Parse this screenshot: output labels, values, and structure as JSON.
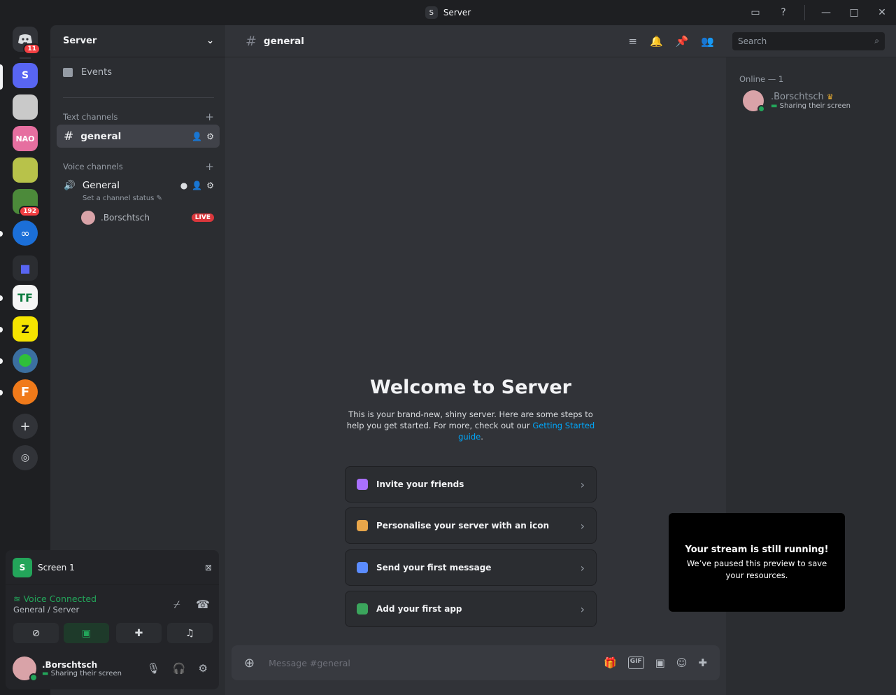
{
  "window": {
    "title": "Server",
    "server_initial": "S"
  },
  "rail": {
    "dm_badge": "11",
    "server_badges": {
      "game": "192"
    }
  },
  "sidebar": {
    "server_name": "Server",
    "events_label": "Events",
    "text_category": "Text channels",
    "voice_category": "Voice channels",
    "text_channel": "general",
    "voice_channel": "General",
    "channel_status_placeholder": "Set a channel status",
    "voice_user": ".Borschtsch",
    "live_badge": "LIVE"
  },
  "header": {
    "channel": "general",
    "search_placeholder": "Search"
  },
  "members": {
    "section": "Online — 1",
    "user": ".Borschtsch",
    "activity": "Sharing their screen"
  },
  "welcome": {
    "title": "Welcome to Server",
    "body": "This is your brand-new, shiny server. Here are some steps to help you get started. For more, check out our ",
    "link": "Getting Started guide",
    "period": "."
  },
  "cards": [
    {
      "label": "Invite your friends",
      "color": "#a970ff"
    },
    {
      "label": "Personalise your server with an icon",
      "color": "#e8a64a"
    },
    {
      "label": "Send your first message",
      "color": "#5b8cff"
    },
    {
      "label": "Add your first app",
      "color": "#3ba55c"
    }
  ],
  "composer": {
    "placeholder": "Message #general"
  },
  "toast": {
    "title": "Your stream is still running!",
    "body": "We’ve paused this preview to save your resources."
  },
  "panel": {
    "screen_label": "Screen 1",
    "voice_status": "Voice Connected",
    "voice_location": "General / Server",
    "user": ".Borschtsch",
    "user_status": "Sharing their screen"
  },
  "colors": {
    "accent": "#5865f2",
    "online": "#23a55a",
    "danger": "#f23f42",
    "link": "#00a8fc"
  }
}
